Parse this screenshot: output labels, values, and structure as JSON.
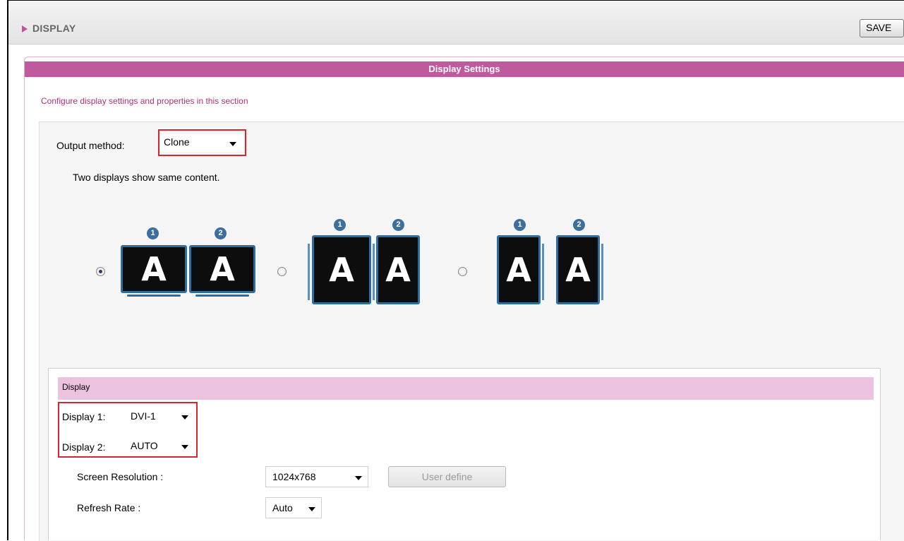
{
  "header": {
    "title": "DISPLAY",
    "save_label": "SAVE"
  },
  "panel": {
    "title": "Display Settings",
    "description": "Configure display settings and properties in this section"
  },
  "output": {
    "label": "Output method:",
    "value": "Clone",
    "hint": "Two displays show same content."
  },
  "layouts": [
    {
      "selected": true,
      "orientation": "landscape",
      "screens": [
        {
          "badge": "1",
          "letter": "A"
        },
        {
          "badge": "2",
          "letter": "A"
        }
      ]
    },
    {
      "selected": false,
      "orientation": "portrait-left",
      "screens": [
        {
          "badge": "1",
          "letter": "A"
        },
        {
          "badge": "2",
          "letter": "A"
        }
      ]
    },
    {
      "selected": false,
      "orientation": "portrait-right",
      "screens": [
        {
          "badge": "1",
          "letter": "A"
        },
        {
          "badge": "2",
          "letter": "A"
        }
      ]
    }
  ],
  "display": {
    "section_title": "Display",
    "display1": {
      "label": "Display 1:",
      "value": "DVI-1"
    },
    "display2": {
      "label": "Display 2:",
      "value": "AUTO"
    },
    "resolution": {
      "label": "Screen Resolution :",
      "value": "1024x768",
      "user_define_label": "User define"
    },
    "refresh": {
      "label": "Refresh Rate :",
      "value": "Auto"
    }
  },
  "colors": {
    "accent": "#bf5a9e",
    "header_row": "#ebc3df",
    "highlight": "#d8262e",
    "monitor_frame": "#2f6d9e"
  }
}
